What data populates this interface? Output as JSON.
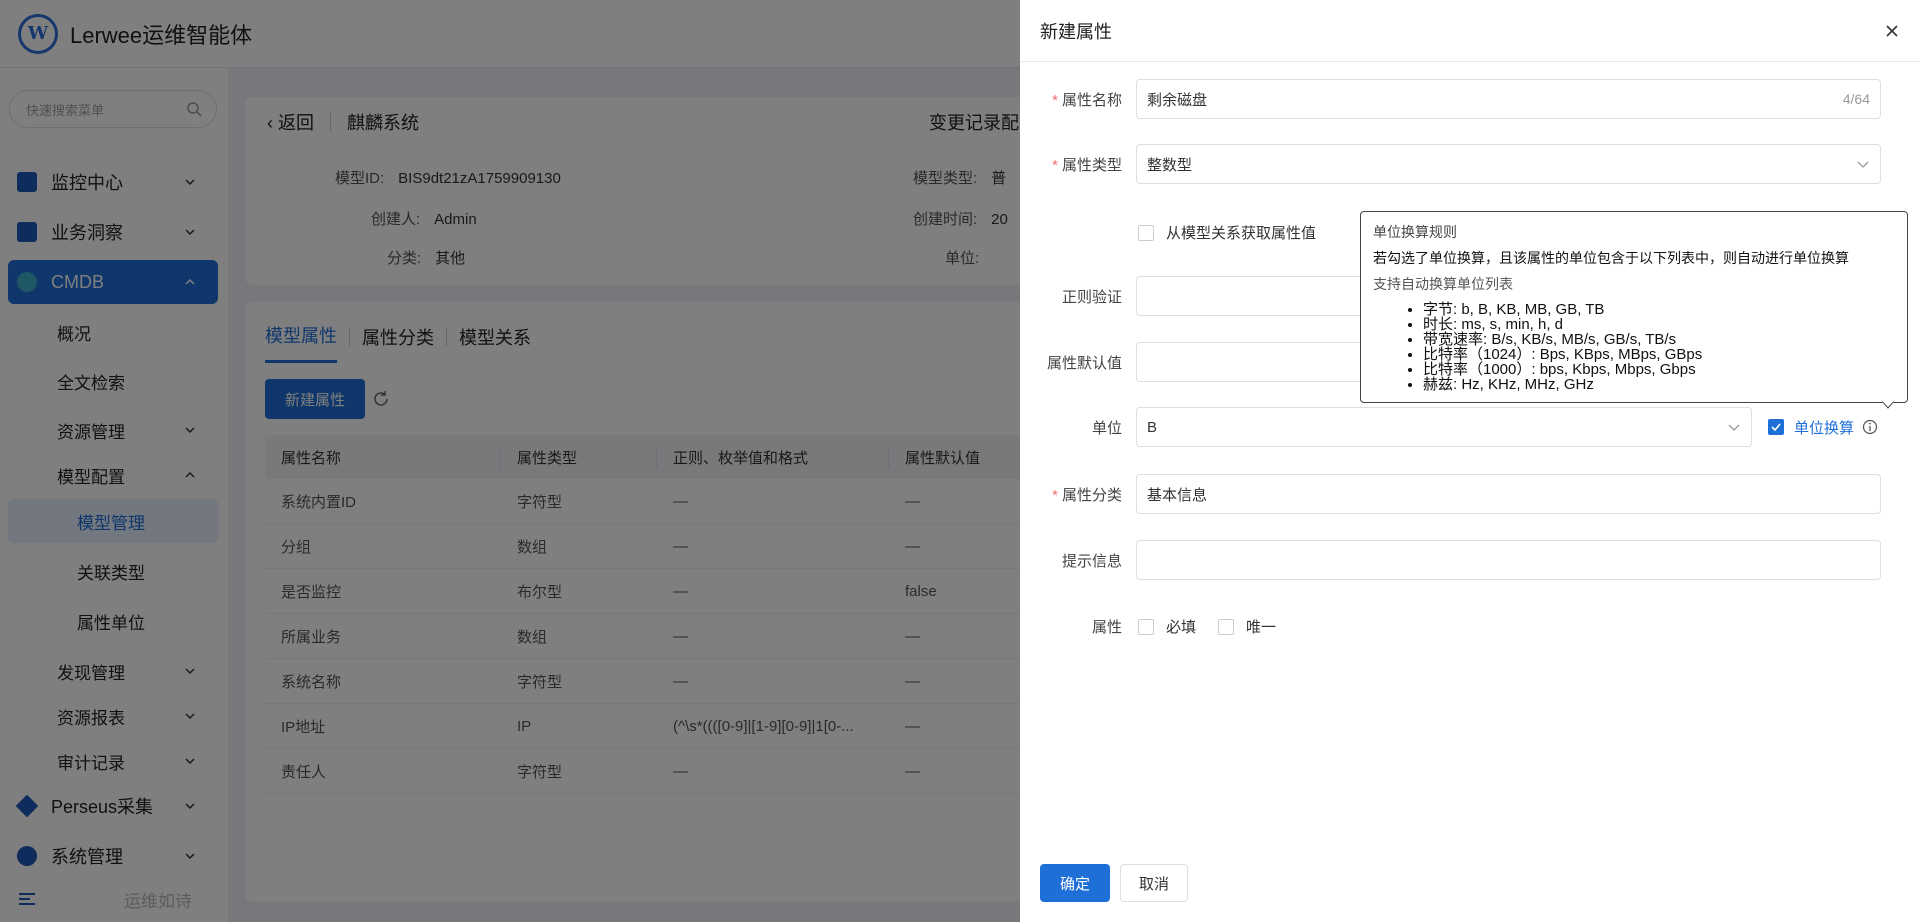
{
  "app": {
    "logo_text": "W",
    "title": "Lerwee运维智能体",
    "slogan": "运维如诗"
  },
  "sidebar": {
    "search_placeholder": "快速搜索菜单",
    "items": [
      {
        "label": "监控中心"
      },
      {
        "label": "业务洞察"
      },
      {
        "label": "CMDB"
      },
      {
        "label": "概况"
      },
      {
        "label": "全文检索"
      },
      {
        "label": "资源管理"
      },
      {
        "label": "模型配置"
      },
      {
        "label": "模型管理"
      },
      {
        "label": "关联类型"
      },
      {
        "label": "属性单位"
      },
      {
        "label": "发现管理"
      },
      {
        "label": "资源报表"
      },
      {
        "label": "审计记录"
      },
      {
        "label": "Perseus采集"
      },
      {
        "label": "系统管理"
      }
    ]
  },
  "detail": {
    "back": "返回",
    "system": "麒麟系统",
    "change_log": "变更记录配",
    "model_id_label": "模型ID:",
    "model_id": "BIS9dt21zA1759909130",
    "creator_label": "创建人:",
    "creator": "Admin",
    "category_label": "分类:",
    "category": "其他",
    "model_type_label": "模型类型:",
    "model_type": "普",
    "created_label": "创建时间:",
    "created": "20",
    "unit_label": "单位:"
  },
  "tabs": [
    "模型属性",
    "属性分类",
    "模型关系"
  ],
  "new_attr_button": "新建属性",
  "table": {
    "headers": [
      "属性名称",
      "属性类型",
      "正则、枚举值和格式",
      "属性默认值"
    ],
    "rows": [
      [
        "系统内置ID",
        "字符型",
        "—",
        "—"
      ],
      [
        "分组",
        "数组",
        "—",
        "—"
      ],
      [
        "是否监控",
        "布尔型",
        "—",
        "false"
      ],
      [
        "所属业务",
        "数组",
        "—",
        "—"
      ],
      [
        "系统名称",
        "字符型",
        "—",
        "—"
      ],
      [
        "IP地址",
        "IP",
        "(^\\s*((([0-9]|[1-9][0-9]|1[0-...",
        "—"
      ],
      [
        "责任人",
        "字符型",
        "—",
        "—"
      ]
    ]
  },
  "drawer": {
    "title": "新建属性",
    "name_label": "属性名称",
    "name_value": "剩余磁盘",
    "name_count": "4/64",
    "type_label": "属性类型",
    "type_value": "整数型",
    "from_relation_label": "从模型关系获取属性值",
    "regex_label": "正则验证",
    "default_label": "属性默认值",
    "unit_label": "单位",
    "unit_value": "B",
    "unit_convert_label": "单位换算",
    "category_label": "属性分类",
    "category_value": "基本信息",
    "hint_label": "提示信息",
    "attr_label": "属性",
    "required_label": "必填",
    "unique_label": "唯一",
    "ok": "确定",
    "cancel": "取消"
  },
  "tooltip": {
    "title": "单位换算规则",
    "desc": "若勾选了单位换算，且该属性的单位包含于以下列表中，则自动进行单位换算",
    "list_title": "支持自动换算单位列表",
    "items": [
      "字节: b, B, KB, MB, GB, TB",
      "时长: ms, s, min, h, d",
      "带宽速率: B/s, KB/s, MB/s, GB/s, TB/s",
      "比特率（1024）: Bps, KBps, MBps, GBps",
      "比特率（1000）: bps, Kbps, Mbps, Gbps",
      "赫兹: Hz, KHz, MHz, GHz"
    ]
  },
  "colors": {
    "primary": "#1f6fd8",
    "required": "#f56c6c",
    "mask": "rgba(0,0,0,0.5)"
  }
}
